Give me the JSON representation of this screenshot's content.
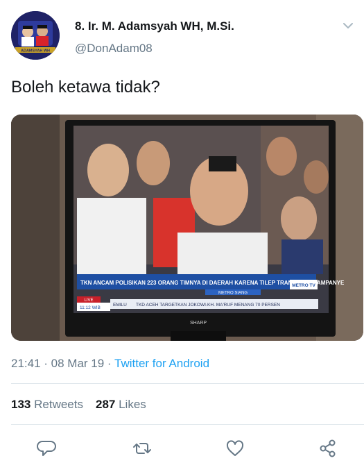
{
  "tweet": {
    "author_name": "8. Ir. M. Adamsyah WH, M.Si.",
    "author_handle": "@DonAdam08",
    "avatar_label": "ADAMSYAH WH",
    "text": "Boleh ketawa tidak?",
    "time": "21:41",
    "separator": " · ",
    "date": "08 Mar 19",
    "source": "Twitter for Android",
    "retweets_count": "133",
    "retweets_label": "Retweets",
    "likes_count": "287",
    "likes_label": "Likes"
  },
  "media": {
    "ticker_headline": "TKN ANCAM POLISIKAN 223 ORANG TIMNYA DI DAERAH  KARENA TILEP TRANSPORT KAMPANYE",
    "channel_label": "METRO SIANG",
    "live_label": "LIVE",
    "clock": "11:12 WIB",
    "ticker_sub_left": "EMILU",
    "ticker_sub": "TKD ACEH TARGETKAN JOKOWI-KH. MA'RUF MENANG 70 PERSEN",
    "channel_logo": "METRO TV",
    "tv_brand": "SHARP"
  },
  "actions": {
    "reply": "reply-icon",
    "retweet": "retweet-icon",
    "like": "heart-icon",
    "share": "share-icon"
  },
  "colors": {
    "link": "#1da1f2",
    "secondary_text": "#657786",
    "primary_text": "#14171a",
    "divider": "#e1e8ed",
    "avatar_bg": "#1d1f5e",
    "ticker_blue": "#1e4fa3",
    "live_red": "#c8202a"
  }
}
